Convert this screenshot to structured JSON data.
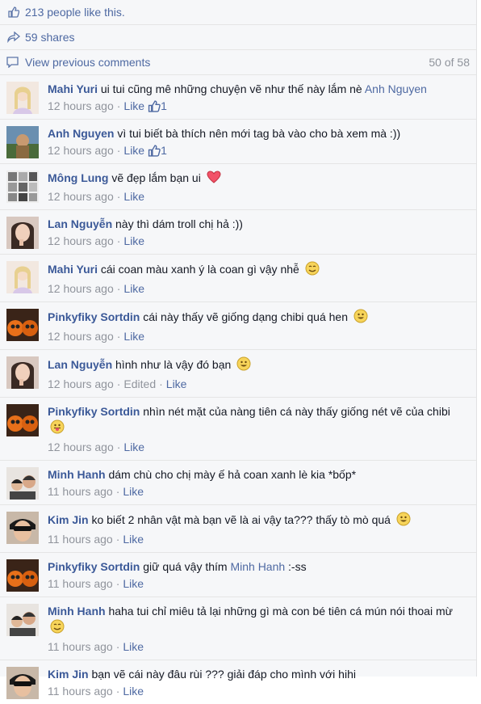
{
  "summary": {
    "likes": "213 people like this.",
    "shares": "59 shares",
    "view_previous": "View previous comments",
    "count": "50 of 58"
  },
  "comments": [
    {
      "name": "Mahi Yuri",
      "text": "ui tui cũng mê những chuyện vẽ như thế này lắm nè",
      "mention": "Anh Nguyen",
      "time": "12 hours ago",
      "like": "Like",
      "likes": "1"
    },
    {
      "name": "Anh Nguyen",
      "text": "vì tui biết bà thích nên mới tag bà vào cho bà xem mà :))",
      "time": "12 hours ago",
      "like": "Like",
      "likes": "1"
    },
    {
      "name": "Mông Lung",
      "text": "vẽ đẹp lắm bạn ui",
      "time": "12 hours ago",
      "like": "Like"
    },
    {
      "name": "Lan Nguyễn",
      "text": "này thì dám troll chị hả :))",
      "time": "12 hours ago",
      "like": "Like"
    },
    {
      "name": "Mahi Yuri",
      "text": "cái coan màu xanh ý là coan gì vậy nhễ",
      "time": "12 hours ago",
      "like": "Like"
    },
    {
      "name": "Pinkyfiky Sortdin",
      "text": "cái này thấy vẽ giống dạng chibi quá hen",
      "time": "12 hours ago",
      "like": "Like"
    },
    {
      "name": "Lan Nguyễn",
      "text": "hình như là vậy đó bạn",
      "time": "12 hours ago",
      "edited": "Edited",
      "like": "Like"
    },
    {
      "name": "Pinkyfiky Sortdin",
      "text": "nhìn nét mặt của nàng tiên cá này thấy giống nét vẽ của chibi",
      "time": "12 hours ago",
      "like": "Like"
    },
    {
      "name": "Minh Hanh",
      "text": "dám chù cho chị mày ế hả coan xanh lè kia *bốp*",
      "time": "11 hours ago",
      "like": "Like"
    },
    {
      "name": "Kim Jin",
      "text": "ko biết 2 nhân vật mà bạn vẽ là ai vậy ta??? thấy tò mò quá",
      "time": "11 hours ago",
      "like": "Like"
    },
    {
      "name": "Pinkyfiky Sortdin",
      "text": "giữ quá vậy thím",
      "mention": "Minh Hanh",
      "tail": ":-ss",
      "time": "11 hours ago",
      "like": "Like"
    },
    {
      "name": "Minh Hanh",
      "text": "haha tui chỉ miêu tả lại những gì mà con bé tiên cá mún nói thoai mừ",
      "time": "11 hours ago",
      "like": "Like"
    },
    {
      "name": "Kim Jin",
      "text": "bạn vẽ cái này đâu rùi ??? giải đáp cho mình với hihi",
      "time": "11 hours ago",
      "like": "Like"
    }
  ],
  "sep": "·"
}
